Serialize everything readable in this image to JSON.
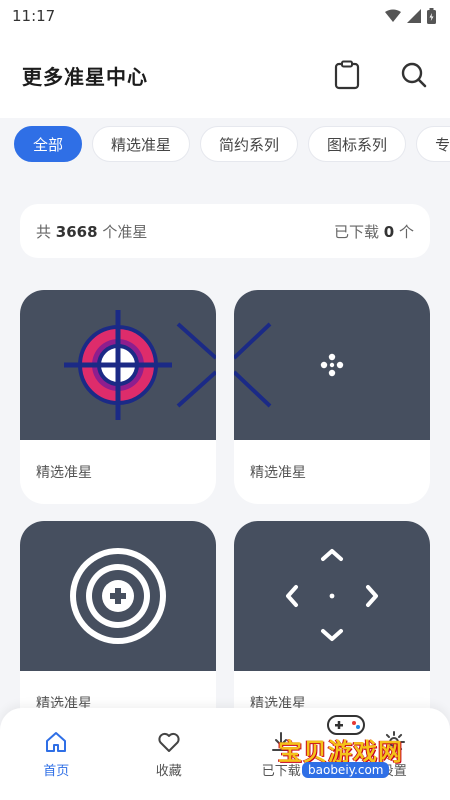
{
  "status": {
    "time": "11:17"
  },
  "header": {
    "title": "更多准星中心",
    "icons": [
      "clipboard-icon",
      "search-icon"
    ]
  },
  "tabs": [
    {
      "label": "全部",
      "active": true
    },
    {
      "label": "精选准星",
      "active": false
    },
    {
      "label": "简约系列",
      "active": false
    },
    {
      "label": "图标系列",
      "active": false
    },
    {
      "label": "专业",
      "active": false
    }
  ],
  "summary": {
    "total_prefix": "共",
    "total_count": "3668",
    "total_suffix": "个准星",
    "downloaded_prefix": "已下载",
    "downloaded_count": "0",
    "downloaded_suffix": "个"
  },
  "cards": [
    {
      "label": "精选准星",
      "preview": "target-crosshair-icon"
    },
    {
      "label": "精选准星",
      "preview": "dot-cross-crosshair-icon"
    },
    {
      "label": "精选准星",
      "preview": "circle-plus-crosshair-icon"
    },
    {
      "label": "精选准星",
      "preview": "arrow-crosshair-icon"
    }
  ],
  "nav": [
    {
      "label": "首页",
      "icon": "home-icon",
      "active": true
    },
    {
      "label": "收藏",
      "icon": "heart-icon",
      "active": false
    },
    {
      "label": "已下载",
      "icon": "download-icon",
      "active": false
    },
    {
      "label": "设置",
      "icon": "gear-icon",
      "active": false
    }
  ],
  "watermark": {
    "text": "宝贝游戏网",
    "url": "baobeiy.com"
  },
  "colors": {
    "accent": "#2f6fe6",
    "card_preview": "#464f5f",
    "background": "#f4f5f8"
  }
}
